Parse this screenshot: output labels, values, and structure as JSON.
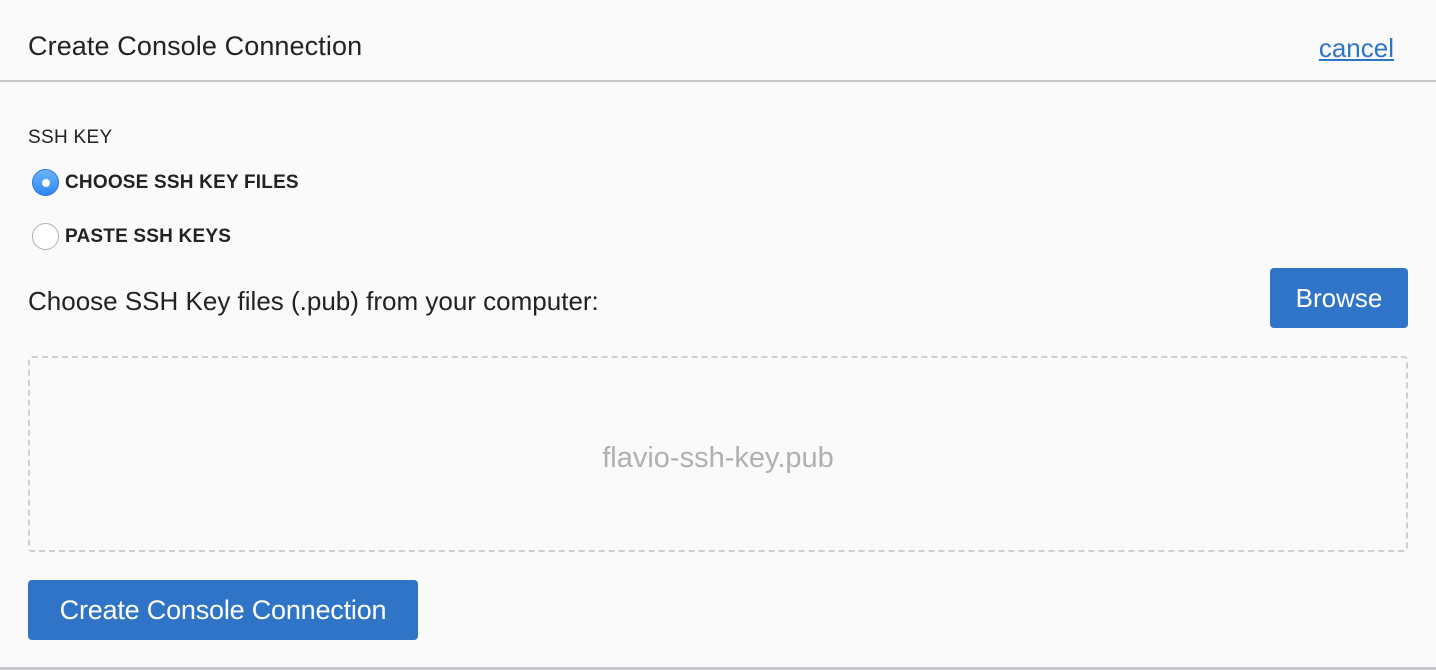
{
  "header": {
    "title": "Create Console Connection",
    "cancel_label": "cancel"
  },
  "ssh_key": {
    "section_label": "SSH KEY",
    "options": [
      {
        "label": "CHOOSE SSH KEY FILES",
        "selected": true
      },
      {
        "label": "PASTE SSH KEYS",
        "selected": false
      }
    ],
    "choose_prompt": "Choose SSH Key files (.pub) from your computer:",
    "browse_label": "Browse",
    "selected_file": "flavio-ssh-key.pub"
  },
  "footer": {
    "create_label": "Create Console Connection"
  },
  "colors": {
    "accent": "#2f74c7",
    "divider": "#c8c8cc",
    "background": "#fafafa"
  }
}
